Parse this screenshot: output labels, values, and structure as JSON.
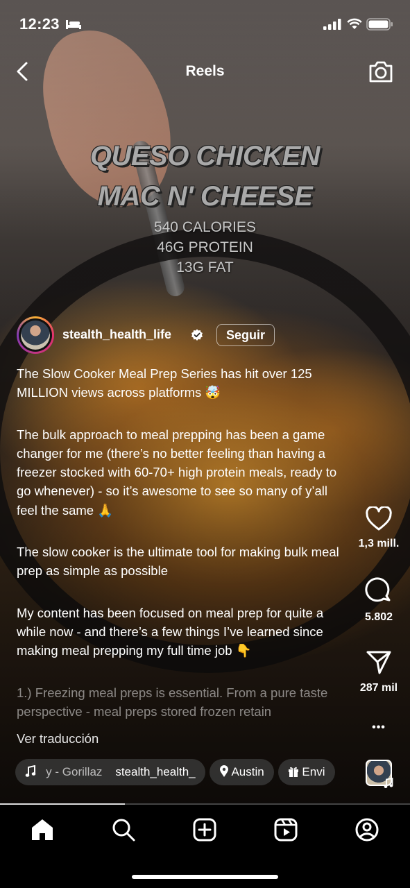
{
  "status_bar": {
    "time": "12:23"
  },
  "header": {
    "title": "Reels"
  },
  "video": {
    "overlay_title_lines": [
      "QUESO CHICKEN",
      "MAC N' CHEESE"
    ],
    "overlay_stats": [
      "540 CALORIES",
      "46G PROTEIN",
      "13G FAT"
    ]
  },
  "author": {
    "username": "stealth_health_life",
    "follow_label": "Seguir"
  },
  "caption": {
    "paragraphs": [
      "The Slow Cooker Meal Prep Series has hit over 125 MILLION views across platforms 🤯",
      "The bulk approach to meal prepping has been a game changer for me (there’s no better feeling than having a freezer stocked with 60-70+ high protein meals, ready to go whenever) - so it’s awesome to see so many of y’all feel the same 🙏",
      "The slow cooker is the ultimate tool for making bulk meal prep as simple as possible",
      "My content has been focused on meal prep for quite a while now - and there’s a few things I’ve learned since making meal prepping my full time job 👇"
    ],
    "truncated": "1.) Freezing meal preps is essential. From a pure taste perspective - meal preps stored frozen retain",
    "translate_label": "Ver traducción"
  },
  "chips": {
    "music_prefix": "y - Gorillaz",
    "music_author": "stealth_health_",
    "location": "Austin",
    "gift": "Envi"
  },
  "actions": {
    "likes": "1,3 mill.",
    "comments": "5.802",
    "shares": "287 mil",
    "more": "•••"
  },
  "progress": {
    "fraction": 0.305
  },
  "nav": {
    "items": [
      "home-icon",
      "search-icon",
      "create-icon",
      "reels-icon",
      "profile-icon"
    ]
  }
}
